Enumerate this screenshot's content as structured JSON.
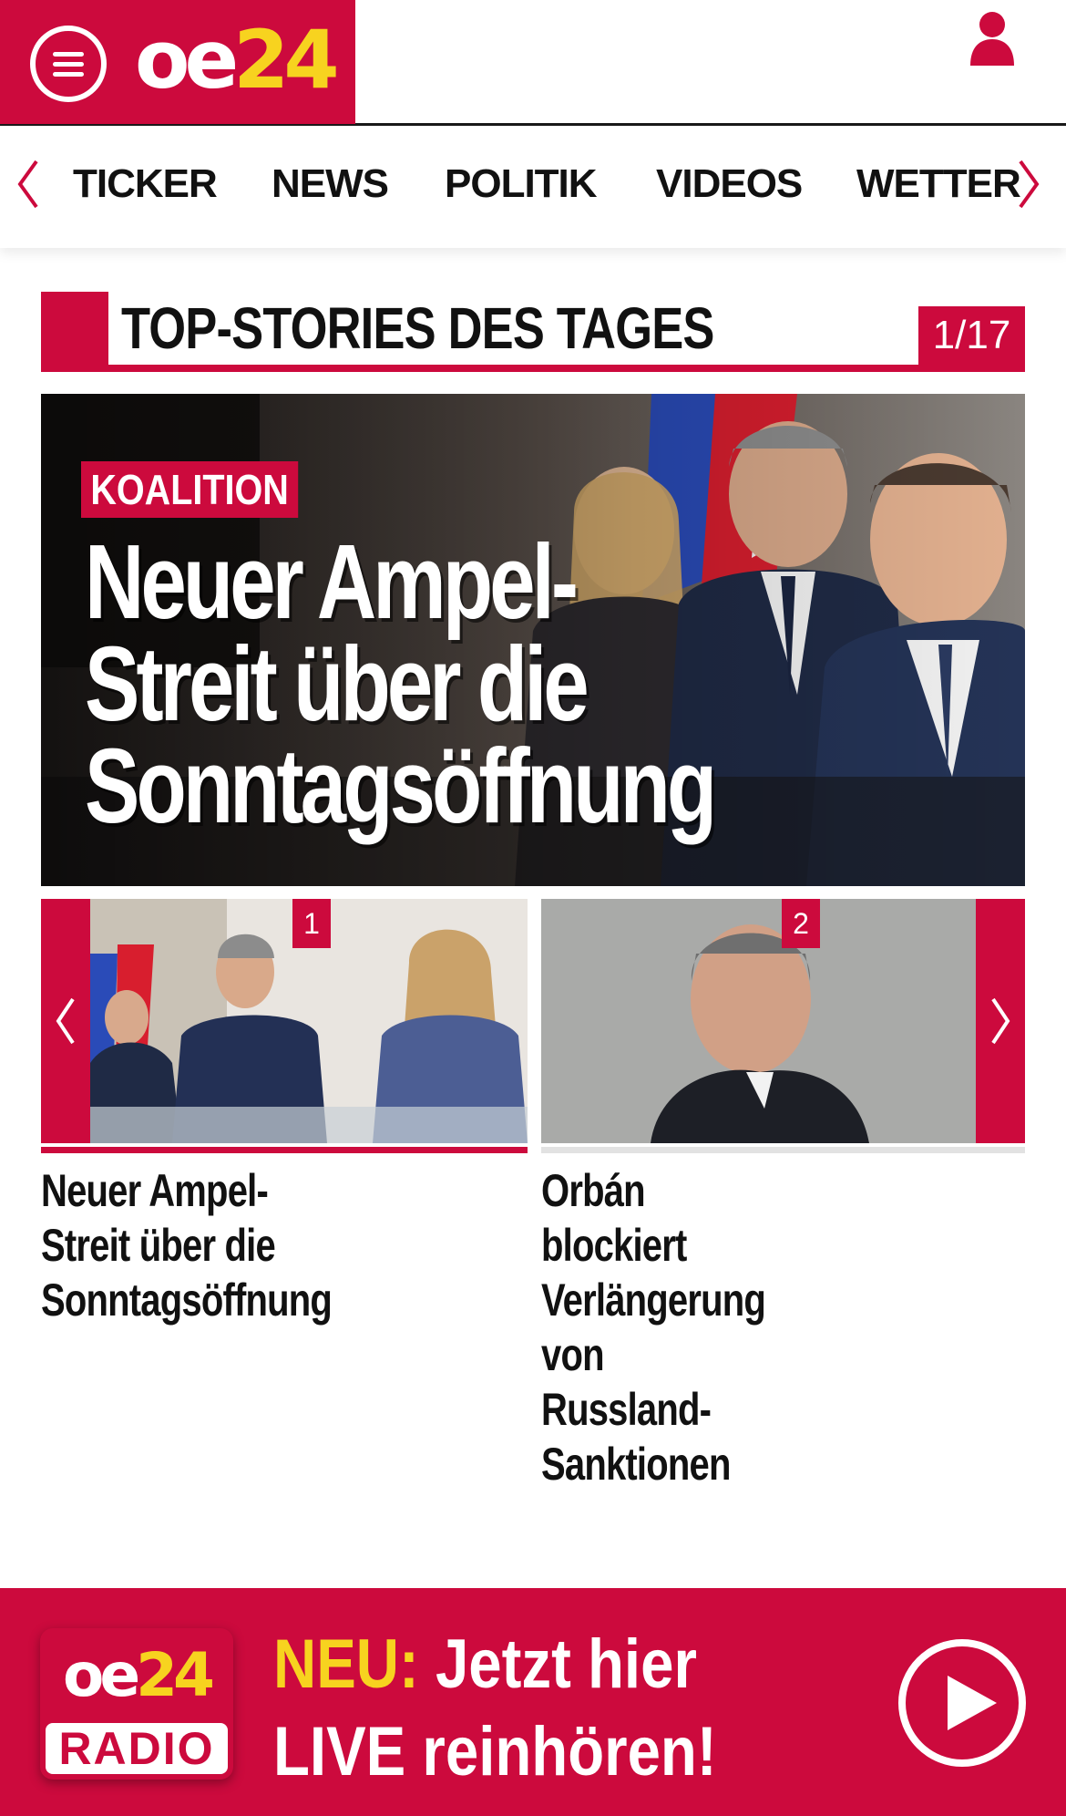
{
  "header": {
    "logo_oe": "oe",
    "logo_24": "24",
    "menu_icon": "hamburger-menu-icon",
    "user_icon": "user-icon"
  },
  "nav": {
    "items": [
      "TICKER",
      "NEWS",
      "POLITIK",
      "VIDEOS",
      "WETTER"
    ],
    "left_arrow_icon": "chevron-left-icon",
    "right_arrow_icon": "chevron-right-icon"
  },
  "section": {
    "title": "TOP-STORIES DES TAGES",
    "counter": "1/17"
  },
  "hero": {
    "tag": "KOALITION",
    "headline": "Neuer Ampel-\nStreit über die\nSonntagsöffnung"
  },
  "carousel": {
    "cards": [
      {
        "number": "1",
        "caption": "Neuer Ampel-Streit über die\nSonntagsöffnung"
      },
      {
        "number": "2",
        "caption": "Orbán blockiert\nVerlängerung von Russland-\nSanktionen"
      }
    ]
  },
  "radio_banner": {
    "logo_oe": "oe",
    "logo_24": "24",
    "logo_radio": "RADIO",
    "neu_label": "NEU:",
    "line1": "Jetzt hier",
    "line2": "LIVE reinhören!",
    "play_icon": "play-icon"
  },
  "colors": {
    "brand_red": "#cc0a3d",
    "brand_yellow": "#f7d31f"
  }
}
